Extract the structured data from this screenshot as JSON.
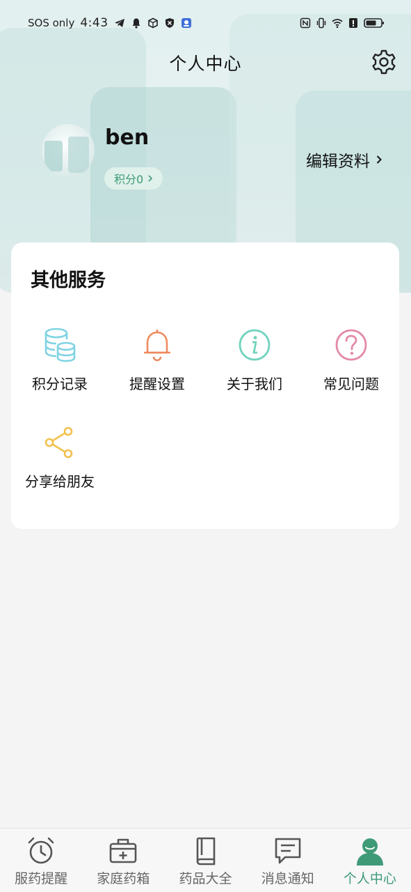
{
  "status_bar": {
    "carrier": "SOS only",
    "time": "4:43",
    "left_icons": [
      "telegram-icon",
      "bell-icon",
      "box-icon",
      "shield-icon",
      "app-icon"
    ],
    "right_icons": [
      "nfc-icon",
      "vibrate-icon",
      "wifi-icon",
      "alert-icon",
      "battery-icon"
    ]
  },
  "header": {
    "title": "个人中心",
    "settings_icon": "gear-icon"
  },
  "profile": {
    "username": "ben",
    "points_label": "积分0",
    "edit_label": "编辑资料"
  },
  "services": {
    "title": "其他服务",
    "items": [
      {
        "label": "积分记录",
        "icon": "database-coins-icon",
        "color": "#7fd3e3"
      },
      {
        "label": "提醒设置",
        "icon": "bell-icon",
        "color": "#ee8a5e"
      },
      {
        "label": "关于我们",
        "icon": "info-icon",
        "color": "#6fd3bd"
      },
      {
        "label": "常见问题",
        "icon": "question-icon",
        "color": "#e38aa5"
      },
      {
        "label": "分享给朋友",
        "icon": "share-icon",
        "color": "#f2c14e"
      }
    ]
  },
  "tabbar": {
    "active_color": "#3f9a78",
    "items": [
      {
        "label": "服药提醒",
        "icon": "alarm-clock-icon"
      },
      {
        "label": "家庭药箱",
        "icon": "medicine-box-icon"
      },
      {
        "label": "药品大全",
        "icon": "book-icon"
      },
      {
        "label": "消息通知",
        "icon": "message-icon"
      },
      {
        "label": "个人中心",
        "icon": "user-icon",
        "active": true
      }
    ]
  }
}
